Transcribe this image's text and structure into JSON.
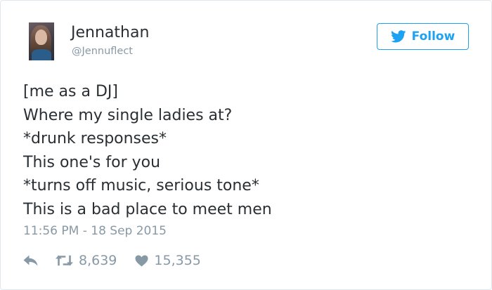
{
  "user": {
    "name": "Jennathan",
    "handle": "@Jennuflect"
  },
  "follow_button": {
    "label": "Follow",
    "icon": "twitter-bird-icon",
    "color": "#1da1f2"
  },
  "tweet": {
    "lines": [
      "[me as a DJ]",
      "Where my single ladies at?",
      "*drunk responses*",
      "This one's for you",
      "*turns off music, serious tone*",
      "This is a bad place to meet men"
    ],
    "timestamp": "11:56 PM - 18 Sep 2015"
  },
  "actions": {
    "reply": {
      "icon": "reply-icon"
    },
    "retweet": {
      "icon": "retweet-icon",
      "count": "8,639"
    },
    "like": {
      "icon": "heart-icon",
      "count": "15,355"
    }
  },
  "colors": {
    "text": "#292f33",
    "muted": "#8899a6",
    "border": "#e1e8ed"
  }
}
